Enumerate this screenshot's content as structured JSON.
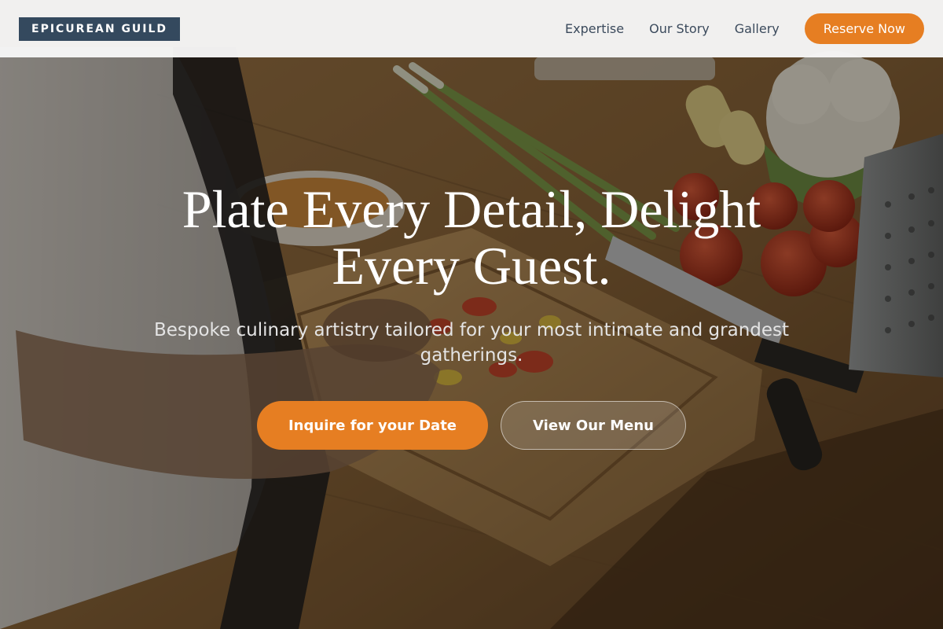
{
  "brand": {
    "logo_text": "EPICUREAN GUILD"
  },
  "nav": {
    "links": [
      "Expertise",
      "Our Story",
      "Gallery"
    ],
    "cta": "Reserve Now"
  },
  "hero": {
    "headline": "Plate Every Detail, Delight Every Guest.",
    "subtitle": "Bespoke culinary artistry tailored for your most intimate and grandest gatherings.",
    "primary_button": "Inquire for your Date",
    "secondary_button": "View Our Menu"
  },
  "colors": {
    "accent": "#e67e22",
    "logo_bg": "#34495e",
    "nav_text": "#3b4a5c"
  }
}
